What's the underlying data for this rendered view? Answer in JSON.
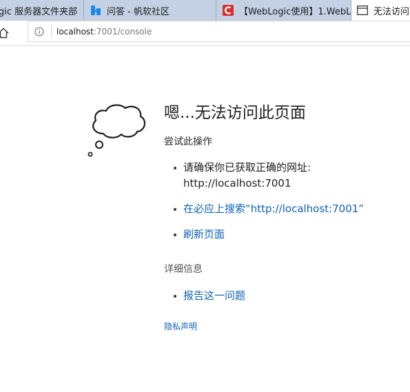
{
  "tabs": [
    {
      "label": "gic 服务器文件夹部"
    },
    {
      "label": "问答 - 帆软社区"
    },
    {
      "label": "【WebLogic使用】1.WebL"
    },
    {
      "label": "无法访问"
    }
  ],
  "address": {
    "host": "localhost",
    "rest": ":7001/console"
  },
  "error": {
    "title": "嗯...无法访问此页面",
    "try_heading": "尝试此操作",
    "tip1_line1": "请确保你已获取正确的网址:",
    "tip1_line2": "http://localhost:7001",
    "tip2": "在必应上搜索“http://localhost:7001”",
    "tip3": "刷新页面",
    "details_heading": "详细信息",
    "report": "报告这一问题",
    "privacy": "隐私声明"
  },
  "colors": {
    "tabstrip": "#b9c8dd",
    "link": "#0f62b5",
    "fanruan_icon": "#1e88e5",
    "csdn_icon": "#d9302c"
  },
  "icons": {
    "home": "home-icon",
    "info": "info-icon",
    "cloud": "thought-cloud-icon"
  }
}
